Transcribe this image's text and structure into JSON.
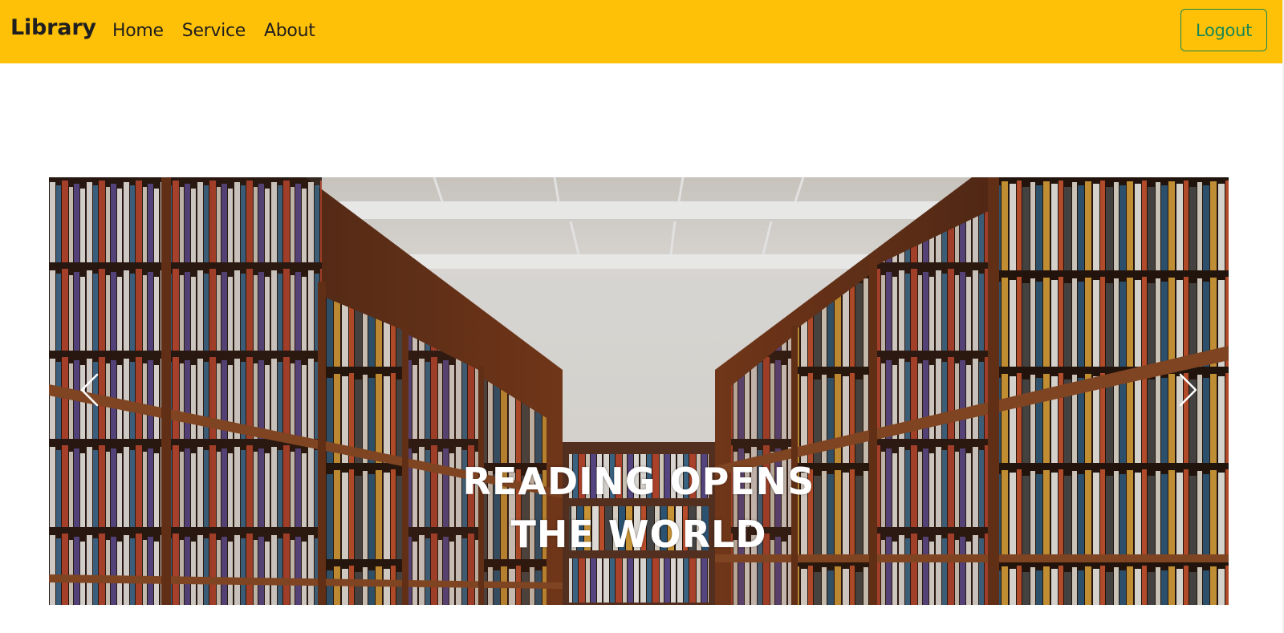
{
  "navbar": {
    "brand": "Library",
    "links": [
      {
        "label": "Home"
      },
      {
        "label": "Service"
      },
      {
        "label": "About"
      }
    ],
    "logout_label": "Logout"
  },
  "carousel": {
    "caption_line1": "READING OPENS",
    "caption_line2": "THE WORLD",
    "prev_icon": "chevron-left-icon",
    "next_icon": "chevron-right-icon"
  },
  "colors": {
    "navbar_bg": "#ffc107",
    "logout_outline": "#198754",
    "text_dark": "#1f1f1f"
  }
}
